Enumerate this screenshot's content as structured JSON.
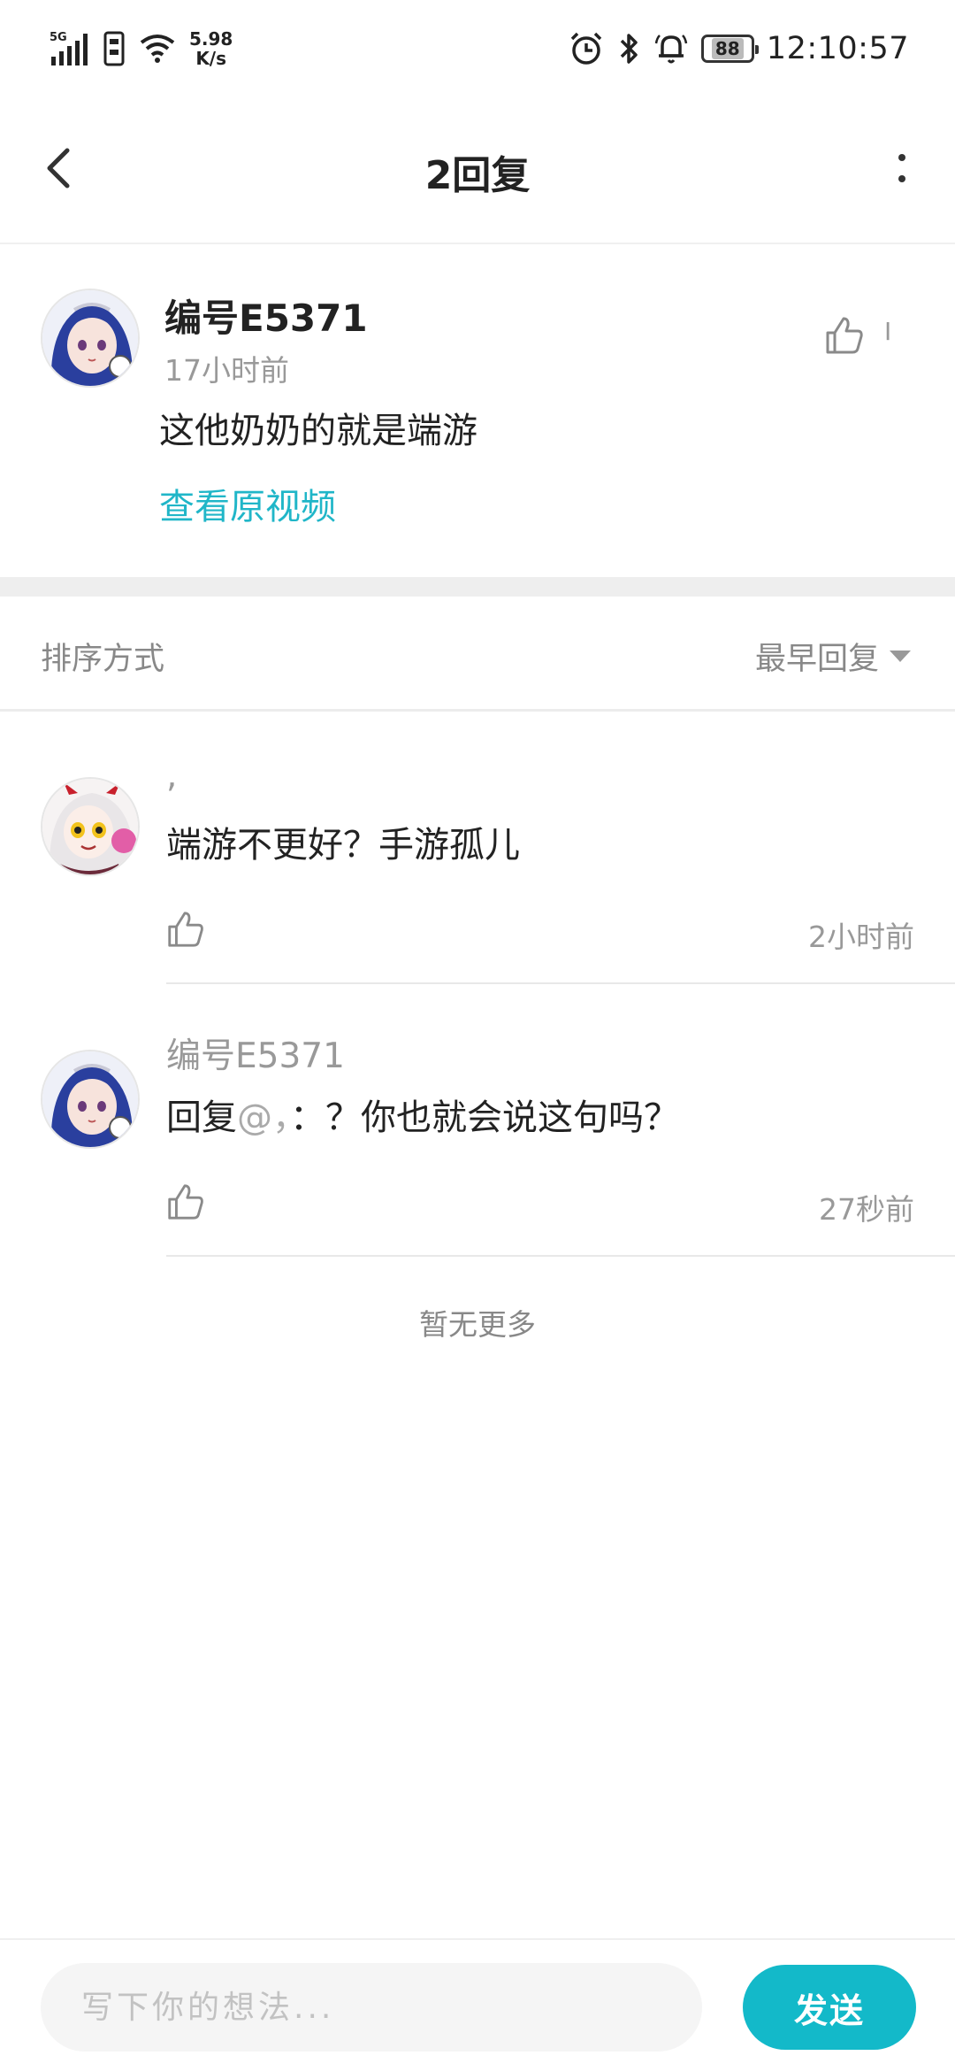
{
  "status_bar": {
    "network": "5G",
    "speed_value": "5.98",
    "speed_unit": "K/s",
    "battery": "88",
    "time": "12:10:57"
  },
  "header": {
    "title": "2回复"
  },
  "original_comment": {
    "author": "编号E5371",
    "time": "17小时前",
    "text": "这他奶奶的就是端游",
    "view_video_link": "查看原视频",
    "like_count": "I"
  },
  "sort": {
    "label": "排序方式",
    "selected": "最早回复"
  },
  "replies": [
    {
      "author": ",",
      "text_prefix": "",
      "text_mention": "",
      "text": "端游不更好？手游孤儿",
      "time": "2小时前"
    },
    {
      "author": "编号E5371",
      "text_prefix": "回复",
      "text_mention": "@，",
      "text": "：？你也就会说这句吗？",
      "time": "27秒前"
    }
  ],
  "footer": {
    "no_more": "暂无更多"
  },
  "input_bar": {
    "placeholder": "写下你的想法...",
    "send_label": "发送"
  },
  "colors": {
    "accent": "#13b9c9",
    "link": "#20b6c8",
    "muted_text": "#999999",
    "primary_text": "#222222"
  }
}
